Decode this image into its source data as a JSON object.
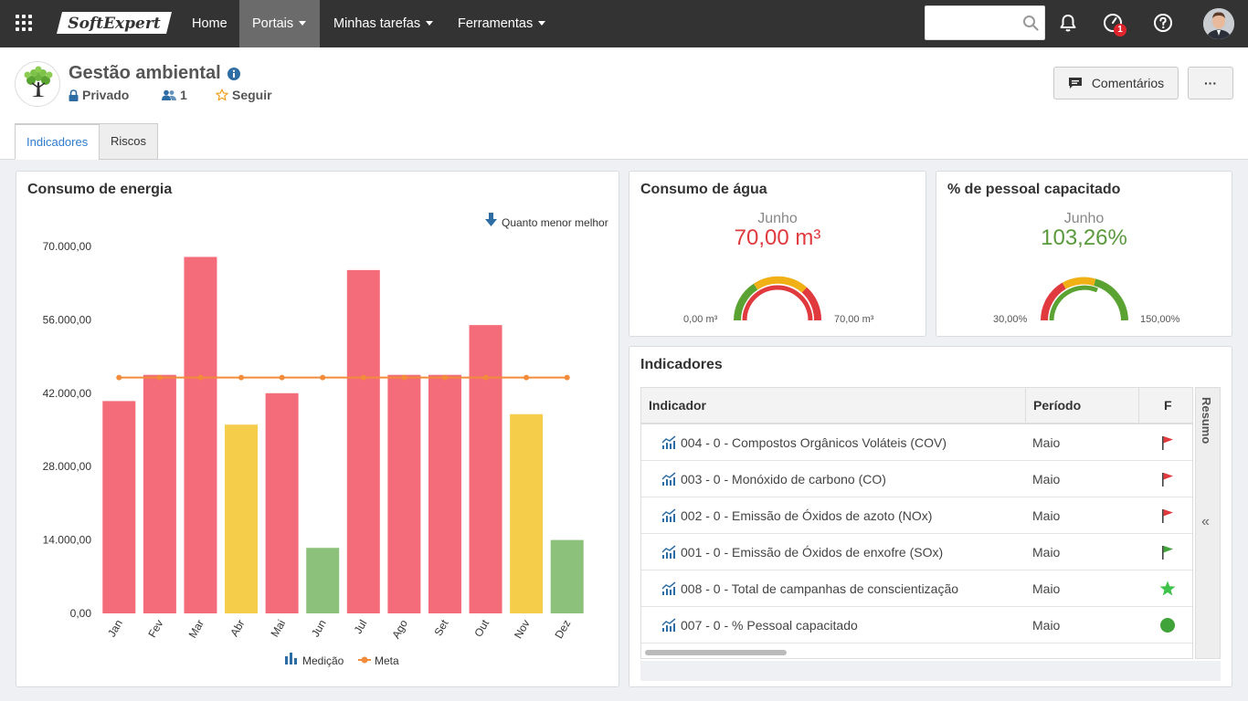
{
  "topbar": {
    "logo_text": "SoftExpert",
    "nav": [
      {
        "label": "Home"
      },
      {
        "label": "Portais"
      },
      {
        "label": "Minhas tarefas"
      },
      {
        "label": "Ferramentas"
      }
    ],
    "search_placeholder": "",
    "notification_count": "1"
  },
  "header": {
    "title": "Gestão ambiental",
    "privacy": "Privado",
    "members": "1",
    "follow": "Seguir",
    "comments_button": "Comentários",
    "more_button": "···",
    "tabs": [
      {
        "label": "Indicadores"
      },
      {
        "label": "Riscos"
      }
    ]
  },
  "energy": {
    "title": "Consumo de energia",
    "hint": "Quanto menor melhor",
    "legend": [
      "Medição",
      "Meta"
    ]
  },
  "chart_data": {
    "type": "bar",
    "categories": [
      "Jan",
      "Fev",
      "Mar",
      "Abr",
      "Mai",
      "Jun",
      "Jul",
      "Ago",
      "Set",
      "Out",
      "Nov",
      "Dez"
    ],
    "series": [
      {
        "name": "Medição",
        "type": "bar",
        "values": [
          40500,
          45500,
          68000,
          36000,
          42000,
          12500,
          65500,
          45500,
          45500,
          55000,
          38000,
          14000
        ],
        "colors": [
          "#f46b7a",
          "#f46b7a",
          "#f46b7a",
          "#f5cd4b",
          "#f46b7a",
          "#8cc17b",
          "#f46b7a",
          "#f46b7a",
          "#f46b7a",
          "#f46b7a",
          "#f5cd4b",
          "#8cc17b"
        ]
      },
      {
        "name": "Meta",
        "type": "line",
        "values": [
          45000,
          45000,
          45000,
          45000,
          45000,
          45000,
          45000,
          45000,
          45000,
          45000,
          45000,
          45000
        ],
        "color": "#f28b3a"
      }
    ],
    "yticks": [
      "0,00",
      "14.000,00",
      "28.000,00",
      "42.000,00",
      "56.000,00",
      "70.000,00"
    ],
    "ylim": [
      0,
      70000
    ]
  },
  "water": {
    "title": "Consumo de água",
    "period": "Junho",
    "value": "70,00 m³",
    "min": "0,00 m³",
    "max": "70,00 m³",
    "value_color": "#e03a3e"
  },
  "trained": {
    "title": "% de pessoal capacitado",
    "period": "Junho",
    "value": "103,26%",
    "min": "30,00%",
    "max": "150,00%",
    "value_color": "#5a9a3c"
  },
  "indicators": {
    "title": "Indicadores",
    "columns": [
      "Indicador",
      "Período",
      "F"
    ],
    "side_tab": "Resumo",
    "rows": [
      {
        "name": "004 - 0 - Compostos Orgânicos Voláteis (COV)",
        "period": "Maio",
        "flag": "red-flag"
      },
      {
        "name": "003 - 0 - Monóxido de carbono (CO)",
        "period": "Maio",
        "flag": "red-flag"
      },
      {
        "name": "002 - 0 - Emissão de Óxidos de azoto (NOx)",
        "period": "Maio",
        "flag": "red-flag"
      },
      {
        "name": "001 - 0 - Emissão de Óxidos de enxofre (SOx)",
        "period": "Maio",
        "flag": "green-flag"
      },
      {
        "name": "008 - 0 - Total de campanhas de conscientização",
        "period": "Maio",
        "flag": "green-star"
      },
      {
        "name": "007 - 0 - % Pessoal capacitado",
        "period": "Maio",
        "flag": "green-circle"
      }
    ]
  }
}
